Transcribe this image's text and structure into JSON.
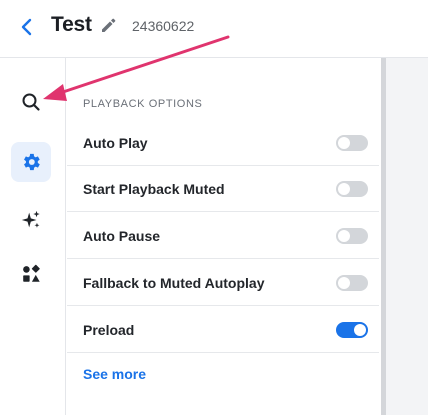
{
  "header": {
    "title": "Test",
    "video_id": "24360622"
  },
  "rail": {
    "items": [
      {
        "icon": "search-icon",
        "active": false
      },
      {
        "icon": "gear-icon",
        "active": true
      },
      {
        "icon": "sparkle-icon",
        "active": false
      },
      {
        "icon": "shapes-icon",
        "active": false
      }
    ]
  },
  "panel": {
    "section_title": "PLAYBACK OPTIONS",
    "options": [
      {
        "label": "Auto Play",
        "enabled": false
      },
      {
        "label": "Start Playback Muted",
        "enabled": false
      },
      {
        "label": "Auto Pause",
        "enabled": false
      },
      {
        "label": "Fallback to Muted Autoplay",
        "enabled": false
      },
      {
        "label": "Preload",
        "enabled": true
      }
    ],
    "see_more": "See more"
  },
  "colors": {
    "accent": "#1a73e8",
    "annotation_arrow": "#e0346e",
    "toggle_off": "#d3d6da"
  }
}
